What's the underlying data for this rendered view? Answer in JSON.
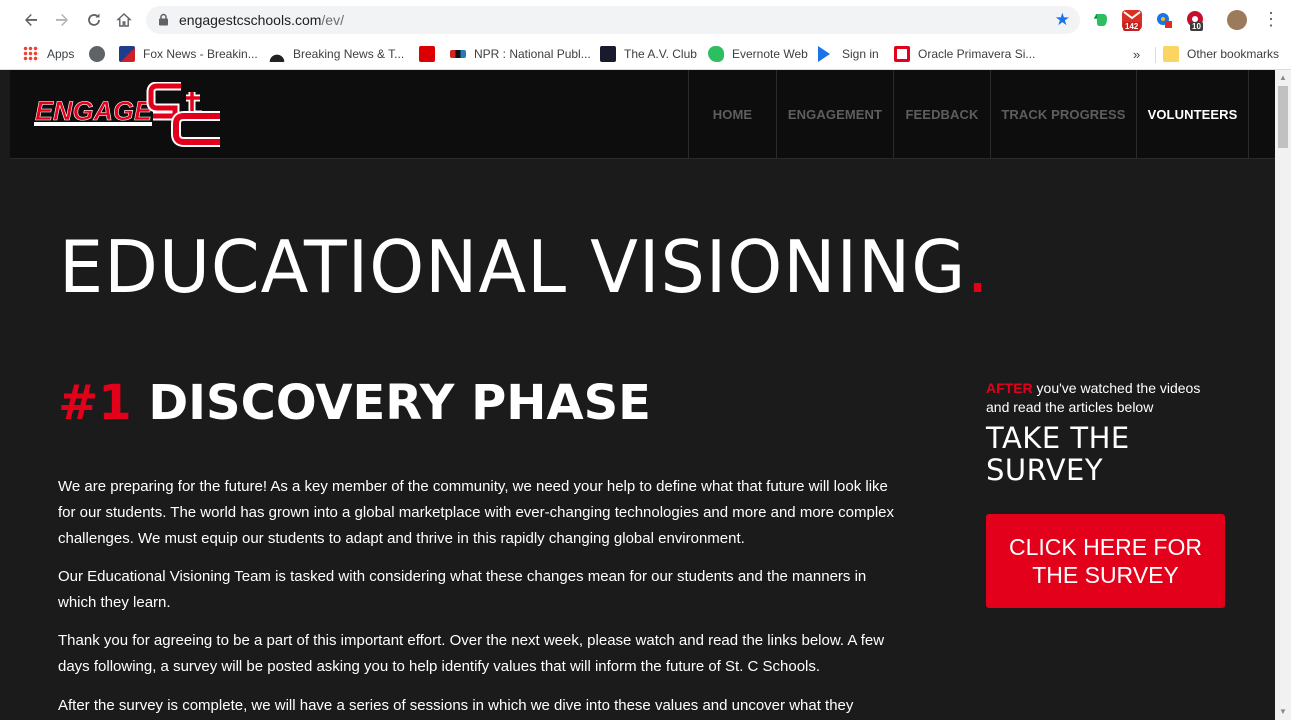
{
  "browser": {
    "url_host": "engagestcschools.com",
    "url_path": "/ev/",
    "extension_badges": [
      "142",
      "10"
    ]
  },
  "bookmarks": {
    "items": [
      {
        "label": "Apps",
        "icon": "apps-grid-icon"
      },
      {
        "label": "",
        "icon": "globe-icon"
      },
      {
        "label": "Fox News - Breakin...",
        "icon": "fox-news-icon"
      },
      {
        "label": "Breaking News & T...",
        "icon": "nbc-peacock-icon"
      },
      {
        "label": "",
        "icon": "espn-icon"
      },
      {
        "label": "NPR : National Publ...",
        "icon": "npr-icon"
      },
      {
        "label": "The A.V. Club",
        "icon": "av-club-icon"
      },
      {
        "label": "Evernote Web",
        "icon": "evernote-icon"
      },
      {
        "label": "Sign in",
        "icon": "play-icon"
      },
      {
        "label": "Oracle Primavera Si...",
        "icon": "oracle-icon"
      }
    ],
    "overflow": "»",
    "other": "Other bookmarks"
  },
  "site": {
    "logo_text": "ENGAGE",
    "nav": [
      {
        "label": "HOME",
        "active": false
      },
      {
        "label": "ENGAGEMENT",
        "active": false
      },
      {
        "label": "FEEDBACK",
        "active": false
      },
      {
        "label": "TRACK PROGRESS",
        "active": false
      },
      {
        "label": "VOLUNTEERS",
        "active": true
      }
    ]
  },
  "hero": {
    "title": "EDUCATIONAL VISIONING",
    "dot": "."
  },
  "phase": {
    "number": "#1",
    "title": " DISCOVERY PHASE"
  },
  "paragraphs": [
    "We are preparing for the future!  As a key member of the community, we need your help to define what that future will look like for our students.  The world has grown into a global marketplace with ever-changing technologies and more and more complex challenges. We must equip our students to adapt and thrive in this rapidly changing global environment.",
    "Our Educational Visioning Team is tasked with considering what these changes mean for our students and the manners in which they learn.",
    "Thank you for agreeing to be a part of this important effort. Over the next week, please watch and read the links below.  A few days following, a survey will be posted asking you to help identify values that will inform the future of St. C Schools.",
    "After the survey is complete, we will have a series of sessions in which we dive into these values and uncover what they"
  ],
  "sidebar": {
    "intro_highlight": "AFTER",
    "intro_rest": " you've watched the videos and read the articles below",
    "heading": "TAKE THE SURVEY",
    "button": "CLICK HERE FOR THE SURVEY"
  },
  "colors": {
    "accent_red": "#e3001b",
    "background": "#1b1b1b",
    "header": "#0d0d0d"
  }
}
